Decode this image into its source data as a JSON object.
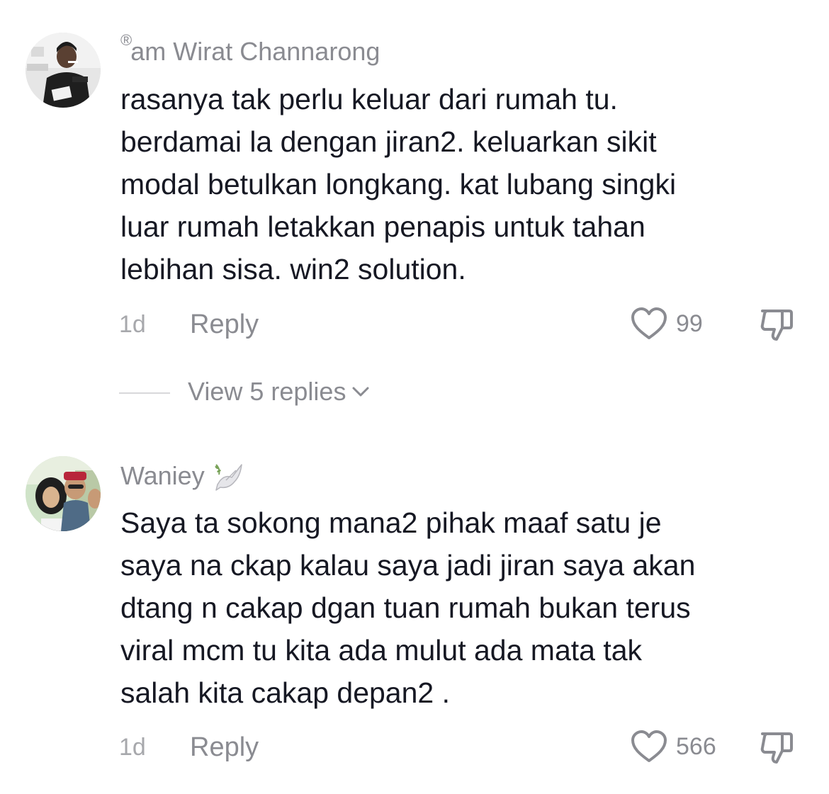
{
  "comments": [
    {
      "reg_mark": "®",
      "username": "am Wirat Channarong",
      "text": "rasanya tak perlu keluar dari rumah tu.\nberdamai la dengan jiran2. keluarkan sikit\nmodal betulkan longkang. kat lubang singki\nluar rumah letakkan penapis untuk tahan\nlebihan sisa. win2 solution.",
      "time": "1d",
      "reply_label": "Reply",
      "likes": "99",
      "view_replies": "View 5 replies"
    },
    {
      "username": "Waniey",
      "username_emoji": "dove-with-olive-branch",
      "text": "Saya ta sokong mana2 pihak maaf satu je\nsaya na ckap kalau saya jadi jiran saya akan\ndtang n cakap dgan tuan rumah bukan terus\nviral mcm tu kita ada mulut ada mata tak\nsalah kita cakap depan2 .",
      "time": "1d",
      "reply_label": "Reply",
      "likes": "566"
    }
  ],
  "colors": {
    "text": "#161823",
    "secondary": "#8a8b91",
    "muted": "#a7a8ac"
  }
}
